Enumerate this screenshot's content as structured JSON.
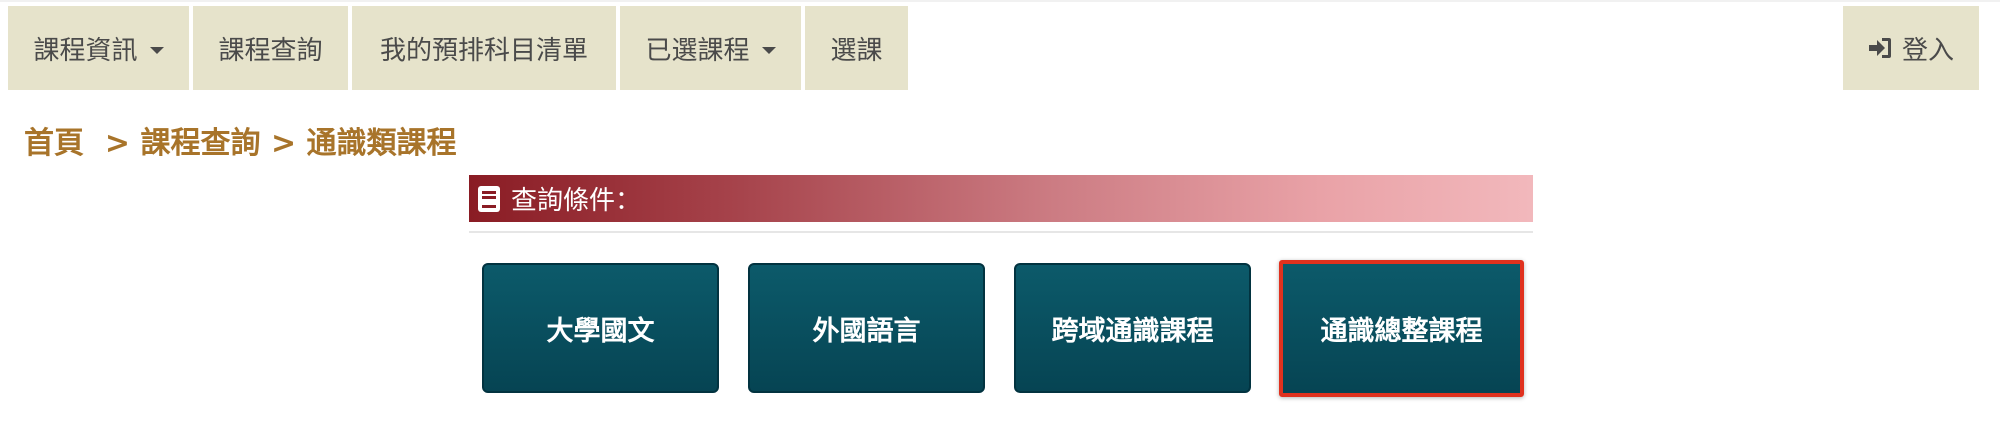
{
  "nav": {
    "items": [
      {
        "label": "課程資訊",
        "has_dropdown": true
      },
      {
        "label": "課程查詢",
        "has_dropdown": false
      },
      {
        "label": "我的預排科目清單",
        "has_dropdown": false
      },
      {
        "label": "已選課程",
        "has_dropdown": true
      },
      {
        "label": "選課",
        "has_dropdown": false
      }
    ],
    "login_label": "登入",
    "login_icon": "sign-in-icon",
    "background_color": "#e6e3cb"
  },
  "breadcrumb": {
    "home": "首頁",
    "separator": ">",
    "level1": "課程查詢",
    "level2": "通識類課程",
    "color": "#a8742a"
  },
  "query": {
    "title": "查詢條件：",
    "icon": "book-icon"
  },
  "categories": [
    {
      "label": "大學國文",
      "selected": false
    },
    {
      "label": "外國語言",
      "selected": false
    },
    {
      "label": "跨域通識課程",
      "selected": false
    },
    {
      "label": "通識總整課程",
      "selected": true
    }
  ],
  "colors": {
    "category_button": "#064453",
    "selected_outline": "#e0311e",
    "query_bar_start": "#8a1c24",
    "query_bar_end": "#f2b8bc"
  }
}
